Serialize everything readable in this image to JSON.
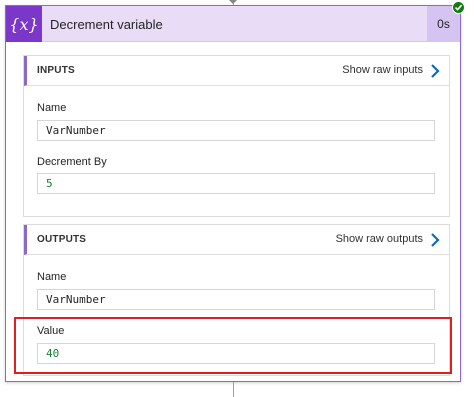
{
  "action": {
    "icon": "variable-icon",
    "icon_text": "{x}",
    "title": "Decrement variable",
    "duration": "0s",
    "status": "succeeded"
  },
  "inputs": {
    "heading": "INPUTS",
    "raw_link": "Show raw inputs",
    "fields": [
      {
        "label": "Name",
        "value": "VarNumber"
      },
      {
        "label": "Decrement By",
        "value": "5"
      }
    ]
  },
  "outputs": {
    "heading": "OUTPUTS",
    "raw_link": "Show raw outputs",
    "fields": [
      {
        "label": "Name",
        "value": "VarNumber"
      },
      {
        "label": "Value",
        "value": "40"
      }
    ]
  },
  "colors": {
    "accent": "#7b37c9",
    "header_bg": "#e8dcf7",
    "link_chevron": "#0f6cbd",
    "success": "#107c10",
    "highlight": "#e02020",
    "numeric_value": "#1a7f3a"
  }
}
